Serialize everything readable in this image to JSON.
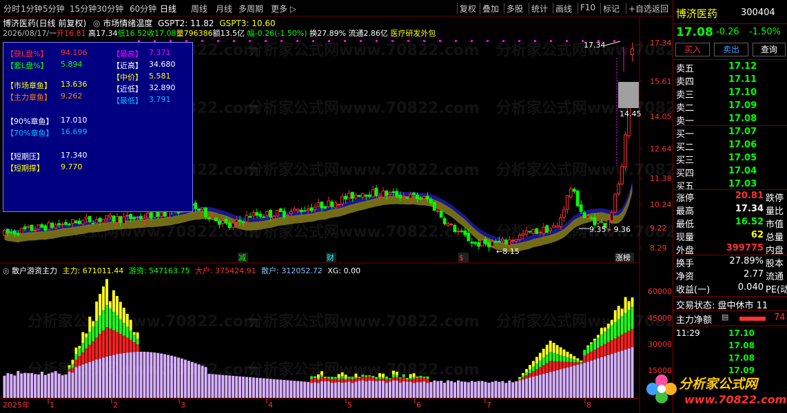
{
  "toolbar": {
    "items": [
      "分时",
      "1分钟",
      "5分钟",
      "15分钟",
      "30分钟",
      "60分钟",
      "日线",
      "周线",
      "月线",
      "多周期",
      "更多 ▷"
    ],
    "right_items": [
      "复权",
      "叠加",
      "多股",
      "统计",
      "画线",
      "F10",
      "标记",
      "+自选",
      "返回"
    ]
  },
  "header": {
    "title": "博济医药(日线 前复权)",
    "indicator": "市场情绪温度",
    "gspt2": "GSPT2: 11.82",
    "gspt3": "GSPT3: 10.60",
    "date": "2026/08/17/一",
    "open": "开16.81",
    "high": "高17.34",
    "low": "低16.52",
    "close": "收17.08",
    "volume": "量796386",
    "amount": "额13.5亿",
    "change": "幅-0.26(-1.50%)",
    "turnover": "换27.89%",
    "float": "流通2.86亿",
    "concept": "医疗研发外包"
  },
  "info_box": {
    "left": [
      {
        "label": "【获L盘%】",
        "value": "94.106",
        "lc": "#ff3030",
        "vc": "#ff3030"
      },
      {
        "label": "【套L盘%】",
        "value": "5.894",
        "lc": "#00ff00",
        "vc": "#00ff00"
      },
      {
        "label": "【市场章鱼】",
        "value": "13.636",
        "lc": "#ffff00",
        "vc": "#ffff00"
      },
      {
        "label": "【主力章鱼】",
        "value": "9.262",
        "lc": "#ff8000",
        "vc": "#ff8000"
      },
      {
        "label": "【90%章鱼】",
        "value": "17.010",
        "lc": "#ffffff",
        "vc": "#ffffff"
      },
      {
        "label": "【70%章鱼】",
        "value": "16.699",
        "lc": "#00c0ff",
        "vc": "#00c0ff"
      },
      {
        "label": "【短期压】",
        "value": "17.340",
        "lc": "#ffffff",
        "vc": "#ffffff"
      },
      {
        "label": "【短期撑】",
        "value": "9.770",
        "lc": "#ffff00",
        "vc": "#ffff00"
      }
    ],
    "right": [
      {
        "label": "【最高】",
        "value": "7.371",
        "lc": "#ff00ff",
        "vc": "#ff00ff"
      },
      {
        "label": "【近高】",
        "value": "34.680",
        "lc": "#ffffff",
        "vc": "#ffffff"
      },
      {
        "label": "【中价】",
        "value": "5.581",
        "lc": "#ffff00",
        "vc": "#ffff00"
      },
      {
        "label": "【近低】",
        "value": "32.890",
        "lc": "#ffffff",
        "vc": "#ffffff"
      },
      {
        "label": "【最低】",
        "value": "3.791",
        "lc": "#00c0ff",
        "vc": "#00c0ff"
      }
    ]
  },
  "price_axis": [
    "17.34",
    "15.61",
    "14.05",
    "12.64",
    "11.38",
    "10.24",
    "9.22",
    "8.29"
  ],
  "price_annotations": {
    "high_label": "17.34",
    "range_label": "9.35 - 9.36",
    "low_label": "8.15",
    "box_label": "14.45"
  },
  "event_markers": [
    {
      "text": "减",
      "color": "#00ff00"
    },
    {
      "text": "财",
      "color": "#00ffff"
    },
    {
      "text": "$",
      "color": "#ff3030"
    },
    {
      "text": "涨榜",
      "color": "#ffffff"
    }
  ],
  "sub_header": {
    "name": "散户游资主力",
    "main": "主力: 671011.44",
    "hot": "游资: 547163.75",
    "big": "大户: 375424.91",
    "retail": "散户: 312052.72",
    "xg": "XG: 0.00"
  },
  "vol_axis": [
    "60000",
    "45000",
    "30000",
    "15000"
  ],
  "x_axis": {
    "year": "2025年",
    "months": [
      "1",
      "2",
      "3",
      "4",
      "5",
      "6",
      "7",
      "8"
    ]
  },
  "watermark": "分析家公式网www.70822.com",
  "right_panel": {
    "name": "博济医药",
    "code": "300404",
    "price": "17.08",
    "change": "-0.26",
    "pct": "-1.50%",
    "buttons": [
      "买入",
      "卖出",
      "查询"
    ],
    "asks": [
      {
        "label": "卖五",
        "price": "17.12"
      },
      {
        "label": "卖四",
        "price": "17.11"
      },
      {
        "label": "卖三",
        "price": "17.10"
      },
      {
        "label": "卖二",
        "price": "17.09"
      },
      {
        "label": "卖一",
        "price": "17.08"
      }
    ],
    "bids": [
      {
        "label": "买一",
        "price": "17.07"
      },
      {
        "label": "买二",
        "price": "17.06"
      },
      {
        "label": "买三",
        "price": "17.05"
      },
      {
        "label": "买四",
        "price": "17.04"
      },
      {
        "label": "买五",
        "price": "17.03"
      }
    ],
    "stats": [
      {
        "l1": "涨停",
        "v1": "20.81",
        "c1": "#ff3030",
        "r1": "跌停"
      },
      {
        "l1": "最高",
        "v1": "17.34",
        "c1": "#ffffff",
        "r1": "量比"
      },
      {
        "l1": "最低",
        "v1": "16.52",
        "c1": "#00ff00",
        "r1": "市值"
      },
      {
        "l1": "现量",
        "v1": "62",
        "c1": "#ffff00",
        "r1": "总量"
      },
      {
        "l1": "外盘",
        "v1": "399775",
        "c1": "#ff3030",
        "r1": "内盘"
      }
    ],
    "stats2": [
      {
        "l1": "换手",
        "v1": "27.89%",
        "r1": "股本"
      },
      {
        "l1": "净资",
        "v1": "2.77",
        "r1": "流通"
      },
      {
        "l1": "收益(一)",
        "v1": "0.040",
        "r1": "PE(动"
      }
    ],
    "trade_status": "交易状态: 盘中休市 11",
    "net_flow_label": "主力净额",
    "net_flow_value": "74",
    "ticks": [
      {
        "time": "11:29",
        "price": "17.10"
      },
      {
        "time": "",
        "price": "17.08"
      },
      {
        "time": "",
        "price": "17.08"
      },
      {
        "time": "",
        "price": "17.09"
      }
    ],
    "logo_text": "分析家公式网",
    "logo_url": "www.70822.com"
  }
}
